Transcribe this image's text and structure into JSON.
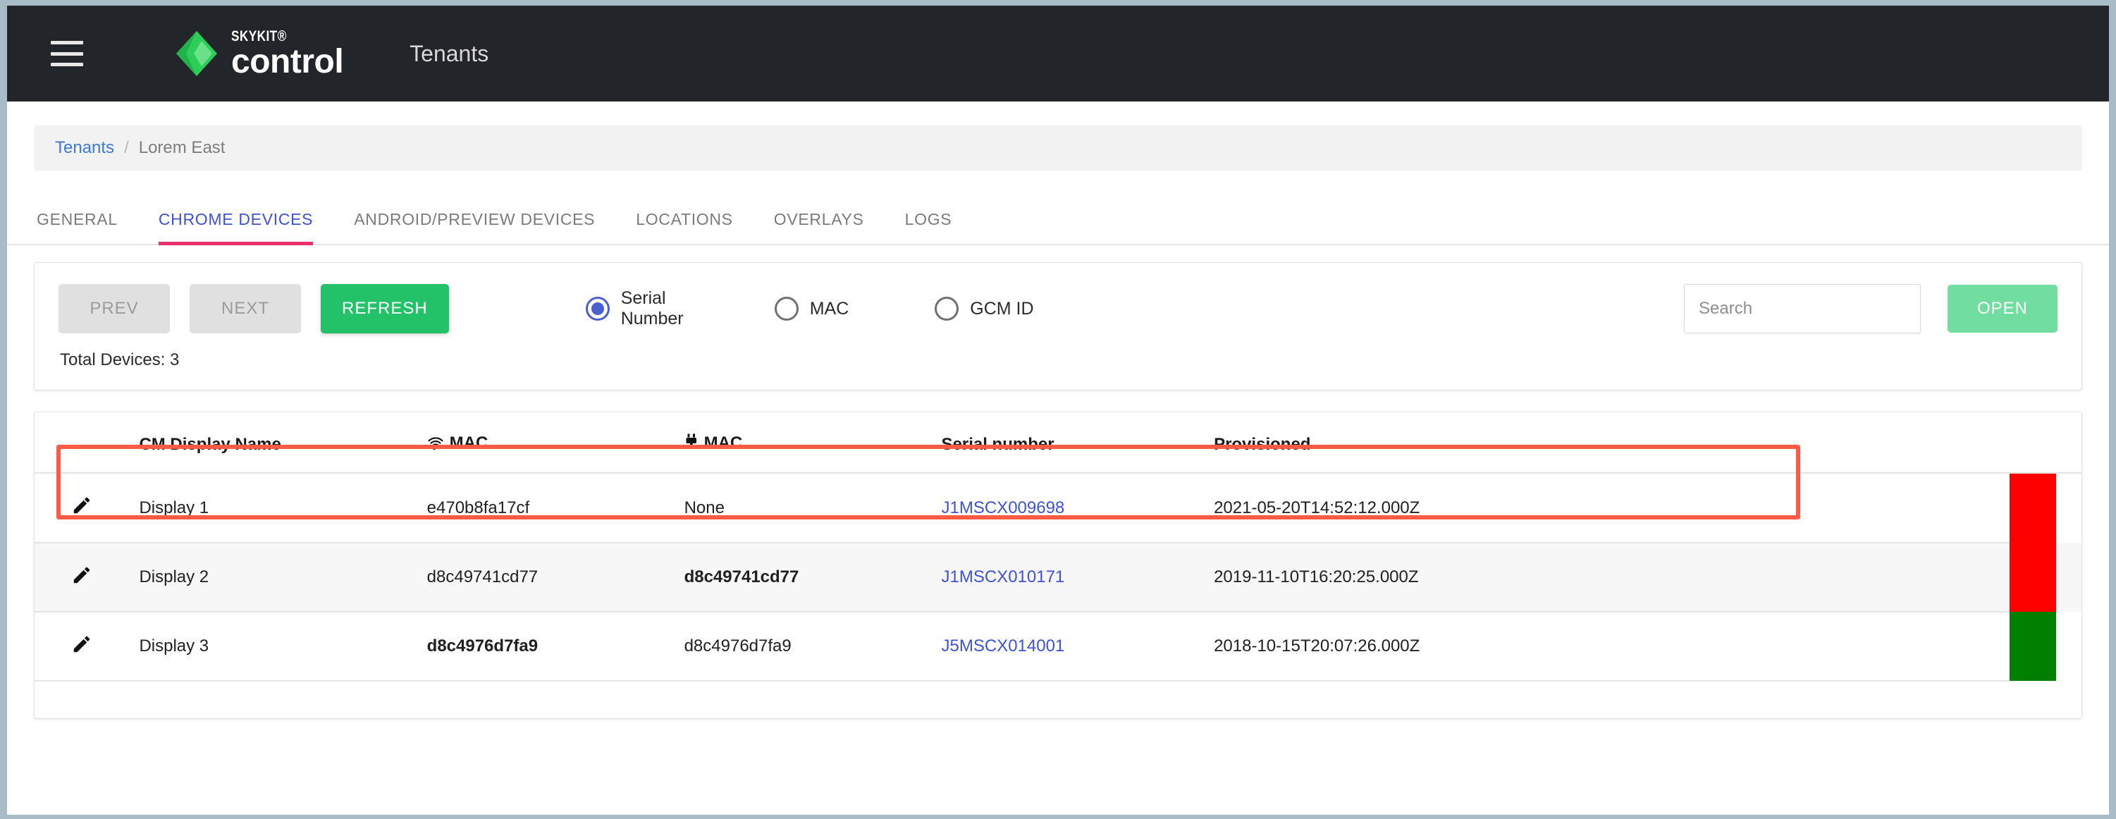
{
  "topbar": {
    "menu_icon": "hamburger-icon",
    "brand_sub": "SKYKIT®",
    "brand_name": "control",
    "title": "Tenants"
  },
  "breadcrumb": {
    "root": "Tenants",
    "separator": "/",
    "current": "Lorem East"
  },
  "tabs": [
    {
      "label": "GENERAL",
      "active": false
    },
    {
      "label": "CHROME DEVICES",
      "active": true
    },
    {
      "label": "ANDROID/PREVIEW DEVICES",
      "active": false
    },
    {
      "label": "LOCATIONS",
      "active": false
    },
    {
      "label": "OVERLAYS",
      "active": false
    },
    {
      "label": "LOGS",
      "active": false
    }
  ],
  "toolbar": {
    "prev_label": "PREV",
    "next_label": "NEXT",
    "refresh_label": "REFRESH",
    "open_label": "OPEN",
    "total_devices": "Total Devices: 3",
    "search": {
      "value": "",
      "placeholder": "Search"
    },
    "search_mode_options": [
      "Serial Number",
      "MAC",
      "GCM ID"
    ],
    "search_mode_selected": "Serial Number",
    "radios": [
      {
        "label": "Serial Number",
        "checked": true
      },
      {
        "label": "MAC",
        "checked": false
      },
      {
        "label": "GCM ID",
        "checked": false
      }
    ]
  },
  "table": {
    "headers": {
      "edit": "",
      "name": "CM Display Name",
      "wifi_mac": "MAC",
      "wifi_icon": "wifi-icon",
      "eth_mac": "MAC",
      "eth_icon": "ethernet-plug-icon",
      "serial": "Serial number",
      "provisioned": "Provisioned"
    },
    "rows": [
      {
        "edit_icon": "pencil-icon",
        "name": "Display 1",
        "wifi_mac": "e470b8fa17cf",
        "wifi_mac_bold": false,
        "eth_mac": "None",
        "eth_mac_bold": false,
        "serial": "J1MSCX009698",
        "provisioned": "2021-05-20T14:52:12.000Z",
        "status_color": "#ff0000",
        "highlighted": true
      },
      {
        "edit_icon": "pencil-icon",
        "name": "Display 2",
        "wifi_mac": "d8c49741cd77",
        "wifi_mac_bold": false,
        "eth_mac": "d8c49741cd77",
        "eth_mac_bold": true,
        "serial": "J1MSCX010171",
        "provisioned": "2019-11-10T16:20:25.000Z",
        "status_color": "#ff0000",
        "highlighted": false
      },
      {
        "edit_icon": "pencil-icon",
        "name": "Display 3",
        "wifi_mac": "d8c4976d7fa9",
        "wifi_mac_bold": true,
        "eth_mac": "d8c4976d7fa9",
        "eth_mac_bold": false,
        "serial": "J5MSCX014001",
        "provisioned": "2018-10-15T20:07:26.000Z",
        "status_color": "#008000",
        "highlighted": false
      }
    ]
  },
  "colors": {
    "topbar_bg": "#22252a",
    "logo_green": "#2ecc58",
    "accent_blue": "#3f51d8",
    "tab_underline": "#e8316d",
    "refresh_green": "#23c268",
    "open_green": "#72dda0",
    "highlight_red": "#fb5b47",
    "status_red": "#ff0000",
    "status_green": "#008000"
  }
}
